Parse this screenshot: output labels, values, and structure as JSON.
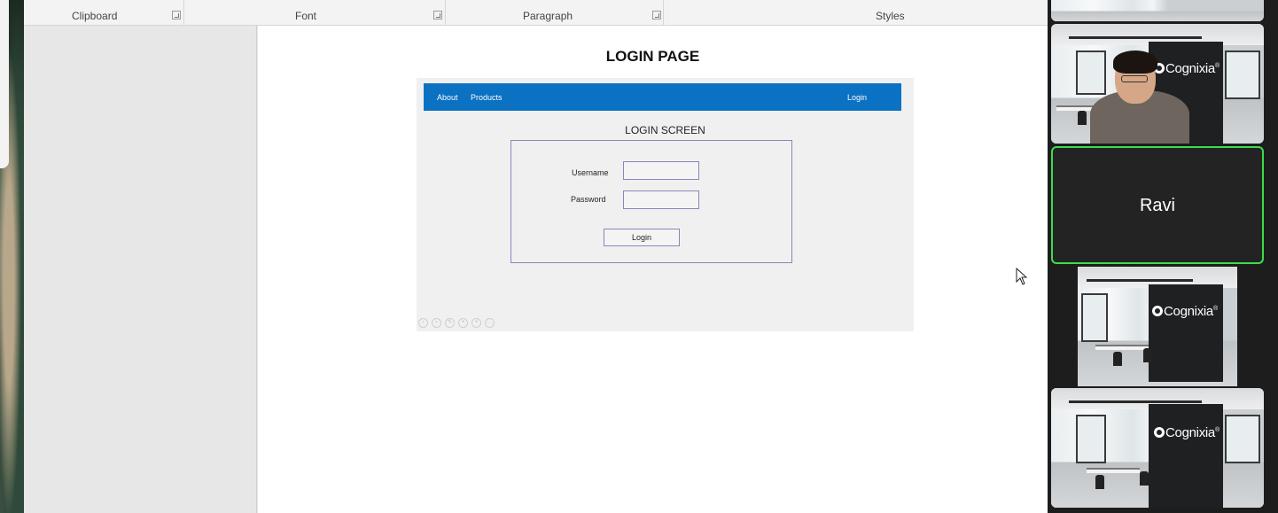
{
  "ribbon": {
    "groups": [
      {
        "label": "Clipboard"
      },
      {
        "label": "Font"
      },
      {
        "label": "Paragraph"
      },
      {
        "label": "Styles"
      }
    ]
  },
  "document": {
    "heading": "LOGIN PAGE",
    "mockup": {
      "nav_links": [
        "About",
        "Products"
      ],
      "nav_login": "Login",
      "title": "LOGIN SCREEN",
      "username_label": "Username",
      "password_label": "Password",
      "button_label": "Login"
    }
  },
  "gallery": {
    "participants": [
      {
        "name": "",
        "type": "video",
        "brand": "Cognixia"
      },
      {
        "name": "Ravi",
        "type": "name-only",
        "active_speaker": true
      },
      {
        "name": "",
        "type": "video",
        "brand": "Cognixia"
      },
      {
        "name": "",
        "type": "video",
        "brand": "Cognixia"
      }
    ],
    "brand_text": "Cognixia",
    "brand_trademark": "®",
    "active_border_color": "#3ddc4d"
  },
  "colors": {
    "nav_blue": "#0b71c2",
    "mock_border": "#8a86b8",
    "gallery_bg": "#1d1d1d"
  }
}
